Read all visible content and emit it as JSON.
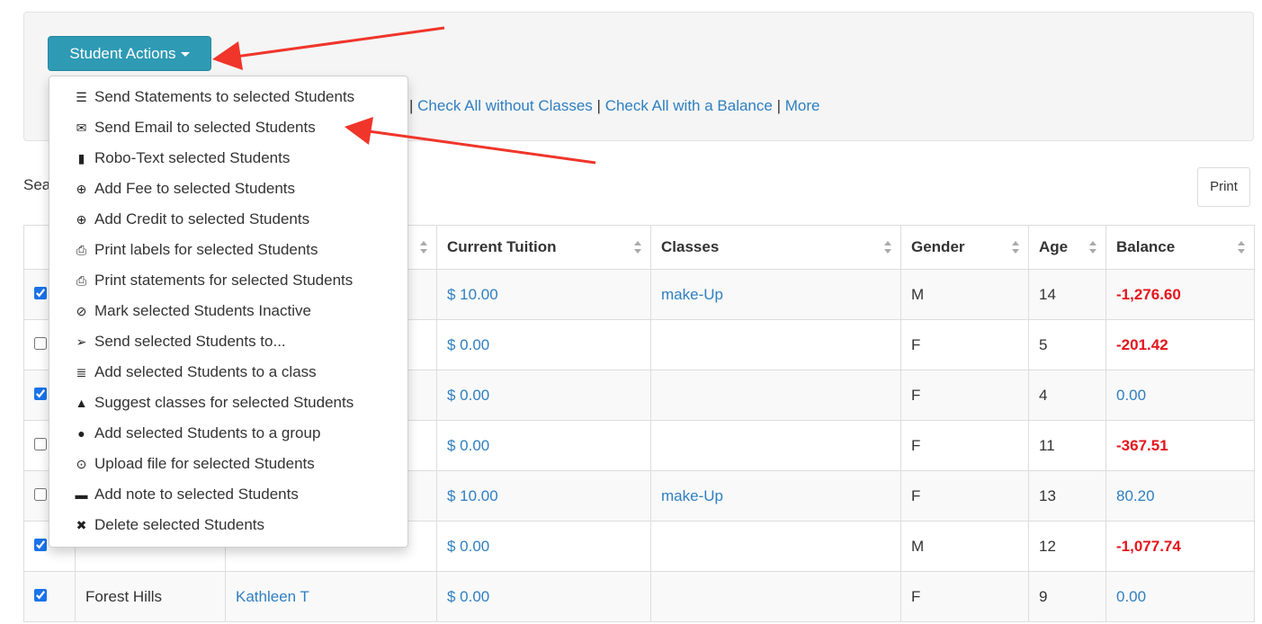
{
  "toolbar": {
    "actions_label": "Student Actions"
  },
  "links": {
    "sep": "|",
    "check_without_classes": "Check All without Classes",
    "check_with_balance": "Check All with a Balance",
    "more": "More"
  },
  "search_label": "Sea",
  "print_label": "Print",
  "menu": {
    "items": [
      {
        "label": "Send Statements to selected Students",
        "icon": "list-icon"
      },
      {
        "label": "Send Email to selected Students",
        "icon": "envelope-icon"
      },
      {
        "label": "Robo-Text selected Students",
        "icon": "signal-icon"
      },
      {
        "label": "Add Fee to selected Students",
        "icon": "plus-circle-icon"
      },
      {
        "label": "Add Credit to selected Students",
        "icon": "plus-circle-icon"
      },
      {
        "label": "Print labels for selected Students",
        "icon": "printer-icon"
      },
      {
        "label": "Print statements for selected Students",
        "icon": "printer-icon"
      },
      {
        "label": "Mark selected Students Inactive",
        "icon": "ban-icon"
      },
      {
        "label": "Send selected Students to...",
        "icon": "paper-plane-icon"
      },
      {
        "label": "Add selected Students to a class",
        "icon": "ordered-list-icon"
      },
      {
        "label": "Suggest classes for selected Students",
        "icon": "road-icon"
      },
      {
        "label": "Add selected Students to a group",
        "icon": "group-icon"
      },
      {
        "label": "Upload file for selected Students",
        "icon": "upload-icon"
      },
      {
        "label": "Add note to selected Students",
        "icon": "comment-icon"
      },
      {
        "label": "Delete selected Students",
        "icon": "x-icon"
      }
    ]
  },
  "table": {
    "headers": {
      "current_tuition": "Current Tuition",
      "classes": "Classes",
      "gender": "Gender",
      "age": "Age",
      "balance": "Balance"
    },
    "rows": [
      {
        "location": "",
        "name": "",
        "tuition": "$ 10.00",
        "classes": "make-Up",
        "gender": "M",
        "age": "14",
        "balance": "-1,276.60"
      },
      {
        "location": "",
        "name": "",
        "tuition": "$ 0.00",
        "classes": "",
        "gender": "F",
        "age": "5",
        "balance": "-201.42"
      },
      {
        "location": "",
        "name": "",
        "tuition": "$ 0.00",
        "classes": "",
        "gender": "F",
        "age": "4",
        "balance": "0.00"
      },
      {
        "location": "",
        "name": "",
        "tuition": "$ 0.00",
        "classes": "",
        "gender": "F",
        "age": "11",
        "balance": "-367.51"
      },
      {
        "location": "",
        "name": "",
        "tuition": "$ 10.00",
        "classes": "make-Up",
        "gender": "F",
        "age": "13",
        "balance": "80.20"
      },
      {
        "location": "",
        "name": "",
        "tuition": "$ 0.00",
        "classes": "",
        "gender": "M",
        "age": "12",
        "balance": "-1,077.74"
      },
      {
        "location": "Forest Hills",
        "name": "Kathleen T",
        "tuition": "$ 0.00",
        "classes": "",
        "gender": "F",
        "age": "9",
        "balance": "0.00"
      }
    ],
    "checked": [
      true,
      false,
      true,
      false,
      false,
      true,
      true
    ]
  },
  "colors": {
    "accent": "#2e9ab4",
    "link": "#2f7fc1",
    "negative": "#e4151c",
    "arrow": "#f0352a"
  }
}
